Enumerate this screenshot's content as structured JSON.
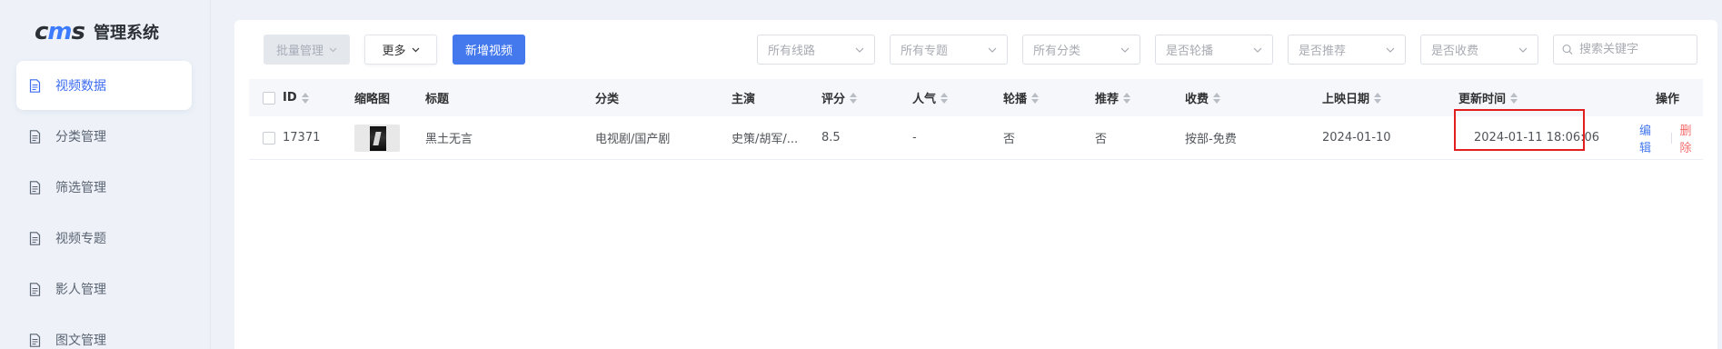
{
  "app": {
    "logo": {
      "text_c": "c",
      "text_m": "m",
      "text_s": "s"
    },
    "title": "管理系统"
  },
  "sidebar": {
    "items": [
      {
        "label": "视频数据",
        "active": true
      },
      {
        "label": "分类管理",
        "active": false
      },
      {
        "label": "筛选管理",
        "active": false
      },
      {
        "label": "视频专题",
        "active": false
      },
      {
        "label": "影人管理",
        "active": false
      },
      {
        "label": "图文管理",
        "active": false
      }
    ]
  },
  "toolbar": {
    "batch_label": "批量管理",
    "more_label": "更多",
    "add_label": "新增视频",
    "filters": [
      {
        "placeholder": "所有线路"
      },
      {
        "placeholder": "所有专题"
      },
      {
        "placeholder": "所有分类"
      },
      {
        "placeholder": "是否轮播"
      },
      {
        "placeholder": "是否推荐"
      },
      {
        "placeholder": "是否收费"
      }
    ],
    "search_placeholder": "搜索关键字"
  },
  "table": {
    "columns": {
      "id": "ID",
      "thumb": "缩略图",
      "title": "标题",
      "category": "分类",
      "actor": "主演",
      "score": "评分",
      "popularity": "人气",
      "carousel": "轮播",
      "recommend": "推荐",
      "fee": "收费",
      "release": "上映日期",
      "updated": "更新时间",
      "ops": "操作"
    },
    "rows": [
      {
        "id": "17371",
        "title": "黑土无言",
        "category": "电视剧/国产剧",
        "actor": "史策/胡军/...",
        "score": "8.5",
        "popularity": "-",
        "carousel": "否",
        "recommend": "否",
        "fee": "按部-免费",
        "release": "2024-01-10",
        "updated": "2024-01-11 18:06:06",
        "edit": "编辑",
        "delete": "删除"
      }
    ]
  },
  "colors": {
    "accent": "#4479ee",
    "danger": "#f56c6c",
    "highlight": "#e21f1f"
  }
}
